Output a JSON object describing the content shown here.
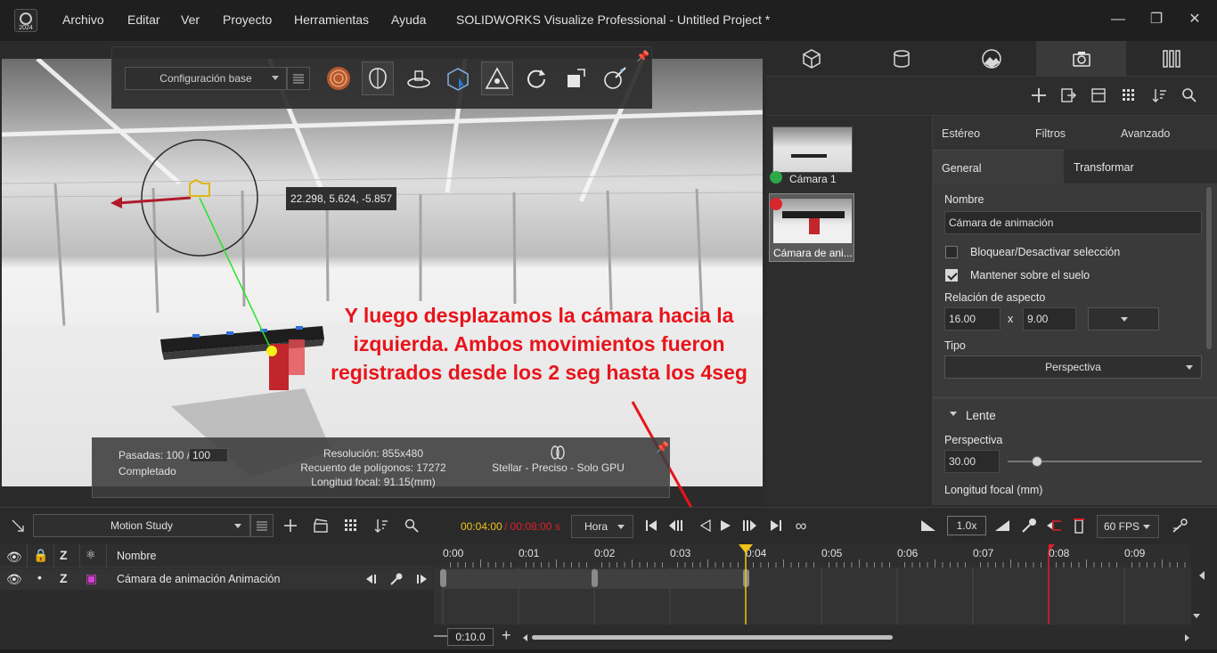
{
  "app": {
    "logo_year": "2024",
    "window_title": "SOLIDWORKS Visualize Professional - Untitled Project *",
    "menu": [
      "Archivo",
      "Editar",
      "Ver",
      "Proyecto",
      "Herramientas",
      "Ayuda"
    ]
  },
  "viewport": {
    "config_select": "Configuración base",
    "coordinates": "22.298, 5.624, -5.857",
    "annotation": "Y luego desplazamos la cámara hacia la izquierda. Ambos movimientos fueron registrados desde los 2 seg hasta los 4seg",
    "stats": {
      "passes_label": "Pasadas: 100 /",
      "passes_value": "100",
      "status": "Completado",
      "resolution": "Resolución: 855x480",
      "polygons": "Recuento de polígonos: 17272",
      "focal": "Longitud focal: 91.15(mm)",
      "render_mode": "Stellar - Preciso - Solo GPU"
    }
  },
  "cameras": [
    {
      "label": "Cámara 1",
      "status": "ok",
      "status_color": "#2ea84a"
    },
    {
      "label": "Cámara de ani...",
      "status": "recording",
      "status_color": "#d9262b"
    }
  ],
  "props": {
    "top_tabs": [
      "Estéreo",
      "Filtros",
      "Avanzado"
    ],
    "sub_tabs": [
      "General",
      "Transformar"
    ],
    "nombre_label": "Nombre",
    "nombre_value": "Cámara de animación",
    "lock_label": "Bloquear/Desactivar selección",
    "lock_checked": false,
    "ground_label": "Mantener sobre el suelo",
    "ground_checked": true,
    "aspect_label": "Relación de aspecto",
    "aspect_w": "16.00",
    "aspect_x": "x",
    "aspect_h": "9.00",
    "tipo_label": "Tipo",
    "tipo_value": "Perspectiva",
    "lente_label": "Lente",
    "perspectiva_label": "Perspectiva",
    "perspectiva_value": "30.00",
    "perspectiva_slider_fraction": 0.15,
    "focal_label": "Longitud focal (mm)"
  },
  "timeline": {
    "study_select": "Motion Study",
    "time_current": "00:04:00",
    "time_total": "/ 00:08:00 s",
    "time_unit": "Hora",
    "speed": "1.0x",
    "fps": "60 FPS",
    "header_name": "Nombre",
    "track_name": "Cámara de animación Animación",
    "ticks": [
      "0:00",
      "0:01",
      "0:02",
      "0:03",
      "0:04",
      "0:05",
      "0:06",
      "0:07",
      "0:08",
      "0:09"
    ],
    "zoom_value": "0:10.0",
    "colors": {
      "current_time": "#f0c419",
      "end_time": "#e0202a",
      "current_text": "#f0c419",
      "total_text": "#e0202a"
    }
  }
}
